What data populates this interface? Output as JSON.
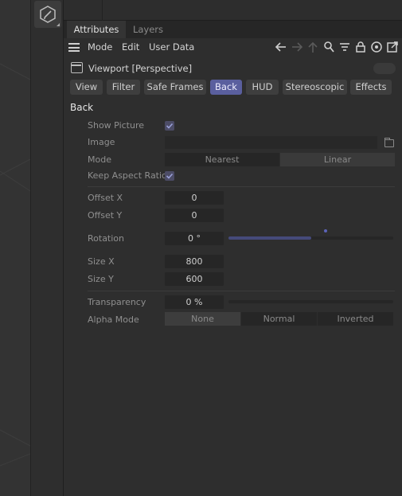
{
  "tabs": [
    "Attributes",
    "Layers"
  ],
  "menu": [
    "Mode",
    "Edit",
    "User Data"
  ],
  "toolbar_icons": [
    "back-arrow-icon",
    "forward-arrow-icon",
    "up-arrow-icon",
    "search-icon",
    "filter-icon",
    "lock-icon",
    "target-icon",
    "new-window-icon"
  ],
  "object": {
    "label": "Viewport [Perspective]"
  },
  "subtabs": [
    "View",
    "Filter",
    "Safe Frames",
    "Back",
    "HUD",
    "Stereoscopic",
    "Effects"
  ],
  "active_subtab": "Back",
  "section": "Back",
  "props": {
    "show_picture": {
      "label": "Show Picture",
      "checked": true
    },
    "image": {
      "label": "Image",
      "value": ""
    },
    "mode": {
      "label": "Mode",
      "options": [
        "Nearest",
        "Linear"
      ],
      "selected": "Nearest"
    },
    "keep_aspect": {
      "label": "Keep Aspect Ratio",
      "checked": true
    },
    "offset_x": {
      "label": "Offset X",
      "value": "0"
    },
    "offset_y": {
      "label": "Offset Y",
      "value": "0"
    },
    "rotation": {
      "label": "Rotation",
      "value": "0 °",
      "slider_fraction": 0.5
    },
    "size_x": {
      "label": "Size X",
      "value": "800"
    },
    "size_y": {
      "label": "Size Y",
      "value": "600"
    },
    "transparency": {
      "label": "Transparency",
      "value": "0 %",
      "slider_fraction": 0
    },
    "alpha_mode": {
      "label": "Alpha Mode",
      "options": [
        "None",
        "Normal",
        "Inverted"
      ],
      "selected": "None"
    }
  },
  "colors": {
    "accent": "#5a5f9e",
    "panel": "#2e2e2e",
    "field": "#262626"
  }
}
